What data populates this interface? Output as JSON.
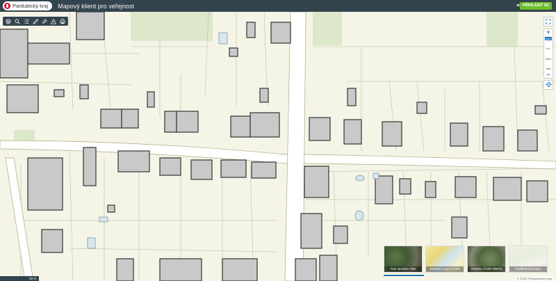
{
  "header": {
    "brand": "Pardubický kraj",
    "title": "Mapový klient pro veřejnost",
    "login_label": "PŘIHLÁSIT SE",
    "share_icon": "share-icon",
    "brand_icon": "pardubicky-kraj-logo-icon"
  },
  "toolbar": {
    "tools": [
      {
        "name": "layers-icon"
      },
      {
        "name": "search-icon"
      },
      {
        "name": "list-icon"
      },
      {
        "name": "measure-ruler-icon"
      },
      {
        "name": "pin-tool-icon"
      },
      {
        "name": "warning-icon"
      },
      {
        "name": "print-icon"
      }
    ]
  },
  "controls": {
    "zoom_in": "+",
    "zoom_out": "–",
    "zoom_levels": [
      "parc",
      "k.ú.",
      "obec",
      "kraj"
    ],
    "active_level": "parc",
    "fullscreen_icon": "fullscreen-icon",
    "locate_icon": "locate-icon"
  },
  "basemaps": [
    {
      "label": "True Ortofoto Tiles",
      "active": true
    },
    {
      "label": "Základní mapa ČÚZK",
      "active": false
    },
    {
      "label": "Ortofoto ČÚZK WMTS",
      "active": false
    },
    {
      "label": "Podkladová mapa",
      "active": false
    }
  ],
  "scale": {
    "label": "20 m"
  },
  "attribution": "© ČÚZK Pardubického kraje",
  "colors": {
    "header_bg": "#34444e",
    "login_bg": "#6cbf2a",
    "accent": "#1c73b6",
    "building": "#c9c9c9",
    "parcel_bg": "#f3f3e6",
    "green_area": "#d8e8c4",
    "road": "#ffffff"
  }
}
